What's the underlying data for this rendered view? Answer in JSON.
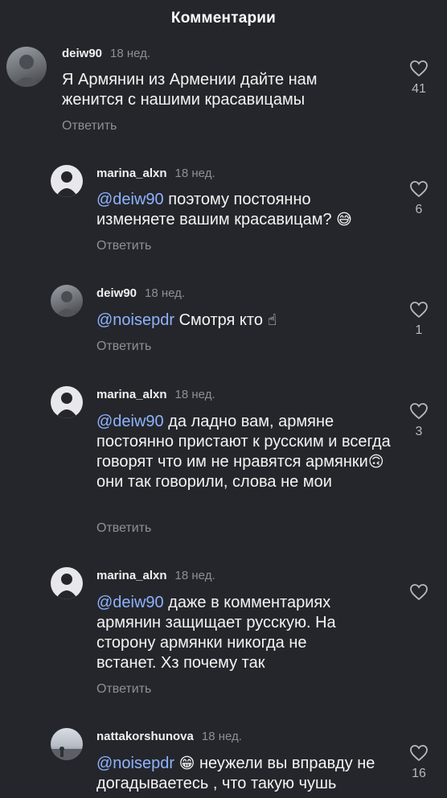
{
  "header": {
    "title": "Комментарии"
  },
  "reply_label": "Ответить",
  "comments": [
    {
      "username": "deiw90",
      "time": "18 нед.",
      "mention": "",
      "text": "Я Армянин из Армении дайте нам женится  с нашими красавицамы",
      "emoji": "",
      "likes": "41",
      "avatar": "photo"
    },
    {
      "username": "marina_alxn",
      "time": "18 нед.",
      "mention": "@deiw90",
      "text": " поэтому постоянно изменяете вашим красавицам? ",
      "emoji": "😅",
      "likes": "6",
      "avatar": "default"
    },
    {
      "username": "deiw90",
      "time": "18 нед.",
      "mention": "@noisepdr",
      "text": " Смотря кто ",
      "emoji": "☝",
      "likes": "1",
      "avatar": "photo"
    },
    {
      "username": "marina_alxn",
      "time": "18 нед.",
      "mention": "@deiw90",
      "text_a": " да ладно вам, армяне постоянно пристают к русским и всегда говорят что им не нравятся армянки",
      "emoji": "🙃",
      "text_b": "они так говорили, слова не мои",
      "likes": "3",
      "avatar": "default"
    },
    {
      "username": "marina_alxn",
      "time": "18 нед.",
      "mention": "@deiw90",
      "text": " даже в комментариях армянин защищает русскую. На сторону армянки никогда не встанет. Хз почему так",
      "emoji": "",
      "likes": "",
      "avatar": "default"
    },
    {
      "username": "nattakorshunova",
      "time": "18 нед.",
      "mention": "@noisepdr",
      "emoji": "😁",
      "text": " неужели вы вправду не догадываетесь , что такую чушь",
      "likes": "16",
      "avatar": "sky"
    }
  ],
  "colors": {
    "background": "#25262b",
    "mention": "#8db3ff",
    "muted": "#8e8f95"
  },
  "icons": {
    "like": "heart-outline-icon"
  }
}
